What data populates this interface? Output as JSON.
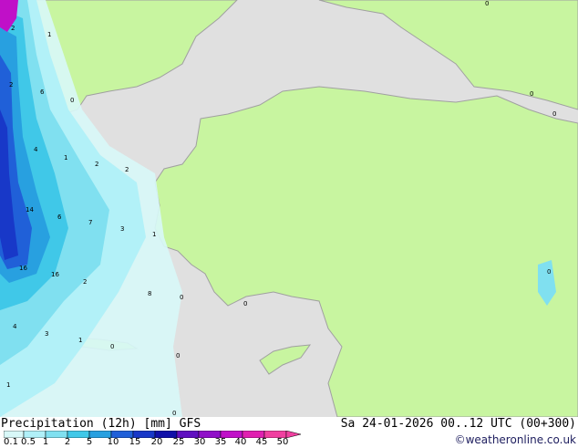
{
  "map": {
    "colors": {
      "sea": "#e0e0e0",
      "land": "#c8f5a0",
      "border": "#a0a0a0",
      "precip_levels": [
        "#d8f8f8",
        "#b0f0f8",
        "#80e0f0",
        "#40c8e8",
        "#28a0e0",
        "#2060d8",
        "#1838c8",
        "#1010a8",
        "#6010c0",
        "#c010c8",
        "#e020b0",
        "#f040a0"
      ]
    },
    "labels": [
      "2",
      "1",
      "6",
      "2",
      "4",
      "1",
      "2",
      "2",
      "14",
      "6",
      "7",
      "3",
      "1",
      "16",
      "16",
      "2",
      "8",
      "0",
      "4",
      "3",
      "1",
      "0",
      "1",
      "0",
      "0",
      "0",
      "0",
      "0",
      "0",
      "0",
      "0"
    ]
  },
  "footer": {
    "title": "Precipitation (12h) [mm] GFS",
    "datetime": "Sa 24-01-2026 00..12 UTC (00+300)",
    "credit": "©weatheronline.co.uk",
    "scale_ticks": [
      "0.1",
      "0.5",
      "1",
      "2",
      "5",
      "10",
      "15",
      "20",
      "25",
      "30",
      "35",
      "40",
      "45",
      "50"
    ]
  }
}
